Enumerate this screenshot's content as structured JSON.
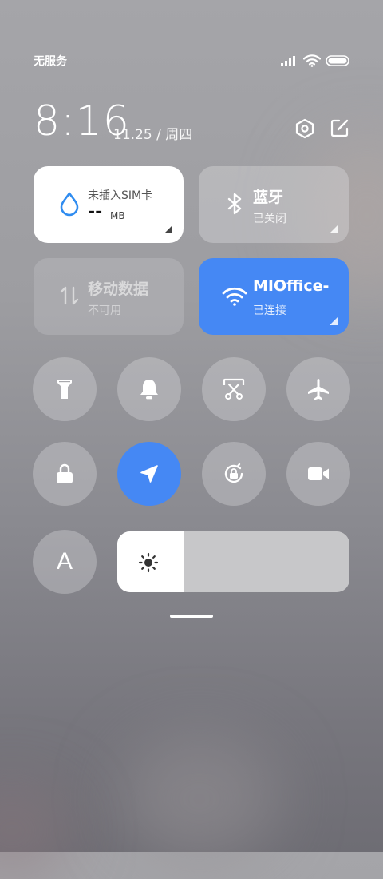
{
  "status_bar": {
    "carrier": "无服务",
    "signal_icon": "cellular-signal-icon",
    "wifi_icon": "wifi-icon",
    "battery_icon": "battery-icon"
  },
  "header": {
    "time": "8:16",
    "date": "11.25 / 周四",
    "settings_icon": "settings-hexagon-icon",
    "edit_icon": "edit-icon"
  },
  "tiles": {
    "data_usage": {
      "title": "未插入SIM卡",
      "value": "--",
      "unit": "MB",
      "icon": "water-drop-icon"
    },
    "bluetooth": {
      "title": "蓝牙",
      "status": "已关闭",
      "icon": "bluetooth-icon"
    },
    "mobile_data": {
      "title": "移动数据",
      "status": "不可用",
      "icon": "mobile-data-arrows-icon"
    },
    "wifi": {
      "title": "MIOffice-",
      "status": "已连接",
      "icon": "wifi-icon"
    }
  },
  "toggles": [
    {
      "name": "flashlight",
      "icon": "flashlight-icon",
      "active": false
    },
    {
      "name": "silent",
      "icon": "bell-icon",
      "active": false
    },
    {
      "name": "screenshot",
      "icon": "screenshot-scissors-icon",
      "active": false
    },
    {
      "name": "airplane-mode",
      "icon": "airplane-icon",
      "active": false
    },
    {
      "name": "lock-screen",
      "icon": "lock-icon",
      "active": false
    },
    {
      "name": "location",
      "icon": "location-arrow-icon",
      "active": true
    },
    {
      "name": "rotation-lock",
      "icon": "rotation-lock-icon",
      "active": false
    },
    {
      "name": "screen-recorder",
      "icon": "video-camera-icon",
      "active": false
    }
  ],
  "font_button": {
    "label": "A"
  },
  "brightness": {
    "level": 0.29,
    "icon": "sun-icon"
  },
  "colors": {
    "accent": "#4588f4",
    "tile_white": "#ffffff",
    "drop_blue": "#2f8cf0"
  }
}
